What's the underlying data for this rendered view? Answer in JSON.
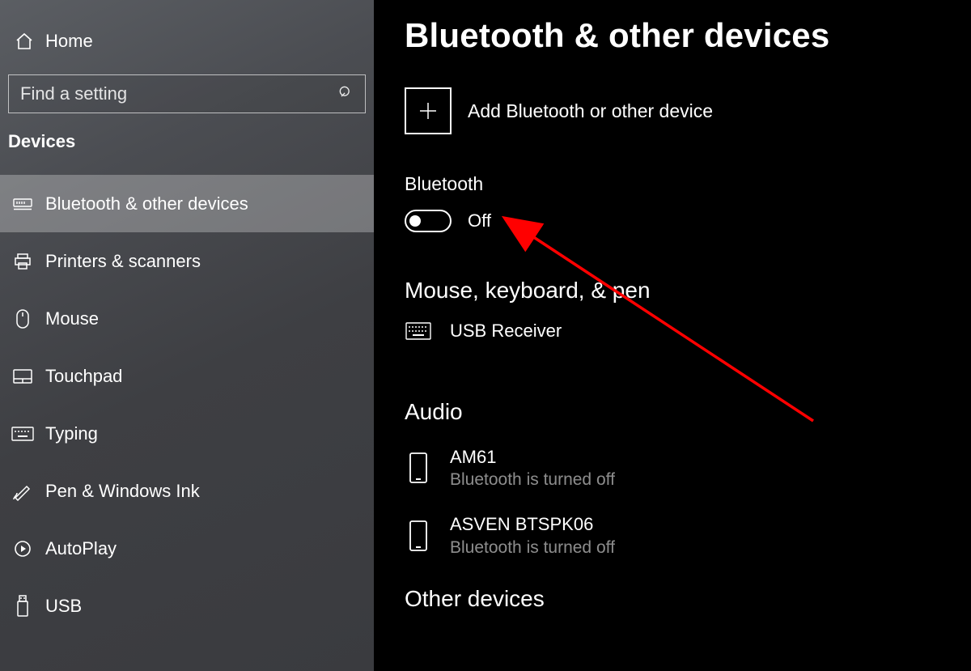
{
  "sidebar": {
    "home_label": "Home",
    "search_placeholder": "Find a setting",
    "section_title": "Devices",
    "items": [
      {
        "label": "Bluetooth & other devices",
        "selected": true
      },
      {
        "label": "Printers & scanners"
      },
      {
        "label": "Mouse"
      },
      {
        "label": "Touchpad"
      },
      {
        "label": "Typing"
      },
      {
        "label": "Pen & Windows Ink"
      },
      {
        "label": "AutoPlay"
      },
      {
        "label": "USB"
      }
    ]
  },
  "main": {
    "page_title": "Bluetooth & other devices",
    "add_device_label": "Add Bluetooth or other device",
    "bluetooth_section_label": "Bluetooth",
    "bluetooth_toggle_state": "Off",
    "mouse_section_label": "Mouse, keyboard, & pen",
    "mouse_devices": [
      {
        "name": "USB Receiver"
      }
    ],
    "audio_section_label": "Audio",
    "audio_devices": [
      {
        "name": "AM61",
        "status": "Bluetooth is turned off"
      },
      {
        "name": "ASVEN BTSPK06",
        "status": "Bluetooth is turned off"
      }
    ],
    "other_section_label": "Other devices"
  },
  "annotation": {
    "type": "red-arrow",
    "points_to": "bluetooth-toggle"
  }
}
